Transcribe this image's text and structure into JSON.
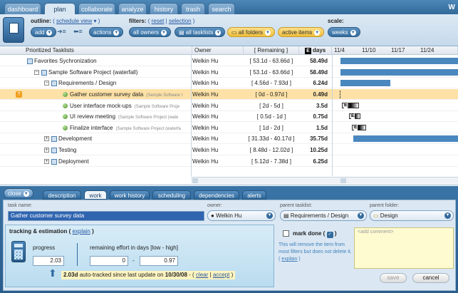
{
  "top_tabs": [
    "dashboard",
    "plan",
    "collaborate",
    "analyze",
    "history",
    "trash",
    "search"
  ],
  "brand": "W",
  "toolbar": {
    "outline_label": "outline:",
    "outline_link": "schedule view",
    "add_label": "add",
    "actions_label": "actions",
    "filters_label": "filters:",
    "reset_link": "reset",
    "selection_link": "selection",
    "owners_filter": "all owners",
    "tasklists_filter": "all tasklists",
    "folders_filter": "all folders",
    "items_filter": "active items",
    "scale_label": "scale:",
    "scale_value": "weeks"
  },
  "grid": {
    "headers": {
      "name": "Prioritized Tasklists",
      "owner": "Owner",
      "remaining": "[ Remaining ]",
      "days": "days"
    },
    "dates": [
      "11/4",
      "11/10",
      "11/17",
      "11/24"
    ],
    "rows": [
      {
        "name": "Favorites Sychronization",
        "owner": "Welkin Hu",
        "remaining": "[ 53.1d - 63.66d ]",
        "days": "58.49d"
      },
      {
        "name": "Sample Software Project (waterfall)",
        "owner": "Welkin Hu",
        "remaining": "[ 53.1d - 63.66d ]",
        "days": "58.49d"
      },
      {
        "name": "Requirements / Design",
        "owner": "Welkin Hu",
        "remaining": "[ 4.56d - 7.93d ]",
        "days": "6.24d"
      },
      {
        "name": "Gather customer survey data",
        "sub": "(Sample Software I",
        "owner": "Welkin Hu",
        "remaining": "[ 0d - 0.97d ]",
        "days": "0.49d"
      },
      {
        "name": "User interface mock-ups",
        "sub": "(Sample Software Proje",
        "owner": "Welkin Hu",
        "remaining": "[ 2d - 5d ]",
        "days": "3.5d"
      },
      {
        "name": "UI review meeting",
        "sub": "(Sample Software Project (wate",
        "owner": "Welkin Hu",
        "remaining": "[ 0.5d - 1d ]",
        "days": "0.75d"
      },
      {
        "name": "Finalize interface",
        "sub": "(Sample Software Project (waterfa",
        "owner": "Welkin Hu",
        "remaining": "[ 1d - 2d ]",
        "days": "1.5d"
      },
      {
        "name": "Development",
        "owner": "Welkin Hu",
        "remaining": "[ 31.33d - 40.17d ]",
        "days": "35.75d"
      },
      {
        "name": "Testing",
        "owner": "Welkin Hu",
        "remaining": "[ 8.48d - 12.02d ]",
        "days": "10.25d"
      },
      {
        "name": "Deployment",
        "owner": "Welkin Hu",
        "remaining": "[ 5.12d - 7.38d ]",
        "days": "6.25d"
      }
    ]
  },
  "bottom": {
    "close_label": "close",
    "tabs": [
      "description",
      "work",
      "work history",
      "scheduling",
      "dependencies",
      "alerts"
    ],
    "task_name_label": "task name:",
    "task_name_value": "Gather customer survey data",
    "owner_label": "owner:",
    "owner_value": "Welkin Hu",
    "parent_tasklist_label": "parent tasklist:",
    "parent_tasklist_value": "Requirements / Design",
    "parent_folder_label": "parent folder:",
    "parent_folder_value": "Design",
    "tracking_title": "tracking & estimation (",
    "explain_link": "explain",
    "tracking_close": ")",
    "progress_label": "progress",
    "progress_value": "2.03",
    "remaining_label": "remaining effort in days [low - high]",
    "remaining_low": "0",
    "remaining_sep": "-",
    "remaining_high": "0.97",
    "autotrack_prefix": "2.03d",
    "autotrack_text": "auto-tracked since last update on",
    "autotrack_date": "10/30/08",
    "clear_link": "clear",
    "accept_link": "accept",
    "mark_done_label": "mark done (",
    "mark_done_note": "This will remove the item from most filters but does not delete it. (",
    "mark_done_explain": "explain",
    "comment_placeholder": "<add comment>",
    "save_label": "save",
    "cancel_label": "cancel"
  }
}
